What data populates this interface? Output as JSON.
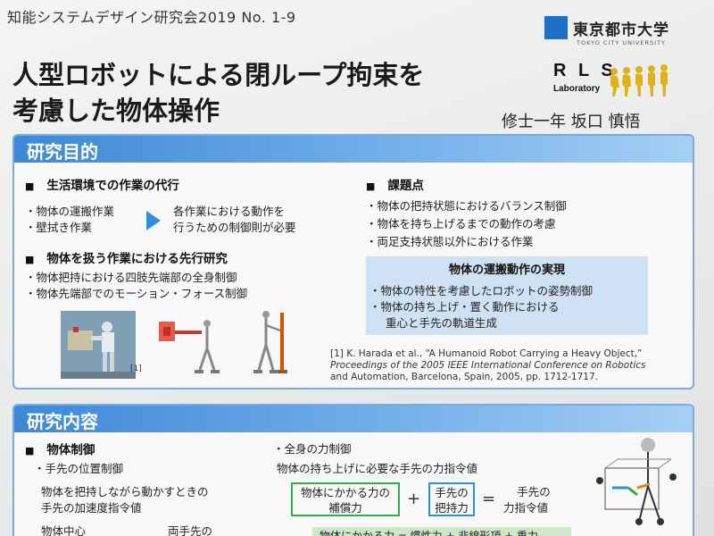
{
  "header": {
    "conference": "知能システムデザイン研究会2019 No. 1-9",
    "university": "東京都市大学",
    "university_en": "TOKYO CITY UNIVERSITY",
    "lab_name": "R L S",
    "lab_sub": "Laboratory",
    "title_line1": "人型ロボットによる閉ループ拘束を",
    "title_line2": "考慮した物体操作",
    "author": "修士一年 坂口 慎悟"
  },
  "purpose": {
    "label": "研究目的",
    "heading1": "生活環境での作業の代行",
    "items1": [
      "物体の運搬作業",
      "壁拭き作業"
    ],
    "arrow_text": [
      "各作業における動作を",
      "行うための制御則が必要"
    ],
    "heading2": "物体を扱う作業における先行研究",
    "items2": [
      "物体把持における四肢先端部の全身制御",
      "物体先端部でのモーション・フォース制御"
    ],
    "issues_heading": "課題点",
    "issues": [
      "物体の把持状態におけるバランス制御",
      "物体を持ち上げるまでの動作の考慮",
      "両足支持状態以外における作業"
    ],
    "goal_title": "物体の運搬動作の実現",
    "goal_items": [
      "物体の特性を考慮したロボットの姿勢制御",
      "物体の持ち上げ・置く動作における"
    ],
    "goal_cont": "重心と手先の軌道生成",
    "figure_label": "[1]",
    "ref_line1": "[1] K. Harada et al., “A Humanoid Robot Carrying a Heavy Object,”",
    "ref_line2": "Proceedings of the 2005 IEEE International Conference on Robotics",
    "ref_line3": "and Automation, Barcelona, Spain, 2005, pp. 1712-1717."
  },
  "content": {
    "label": "研究内容",
    "heading1": "物体制御",
    "item1": "手先の位置制御",
    "text1_line1": "物体を把持しながら動かすときの",
    "text1_line2": "手先の加速度指令値",
    "text_bottom_left": "物体中心",
    "text_bottom_mid": "両手先の",
    "item2": "全身の力制御",
    "text2": "物体の持ち上げに必要な手先の力指令値",
    "box1_line1": "物体にかかる力の",
    "box1_line2": "補償力",
    "plus": "+",
    "box2_line1": "手先の",
    "box2_line2": "把持力",
    "equals": "=",
    "result_line1": "手先の",
    "result_line2": "力指令値",
    "formula_strip": "物体にかかる力 = 慣性力 + 非線形項 + 重力"
  },
  "colors": {
    "section_border": "#7fa9d6",
    "header_blue": "#3d88d6",
    "goal_bg": "#cfe2f3",
    "green_box": "#2fae48",
    "blue_box": "#2f8fd8",
    "uni_blue": "#1d6fc9"
  }
}
